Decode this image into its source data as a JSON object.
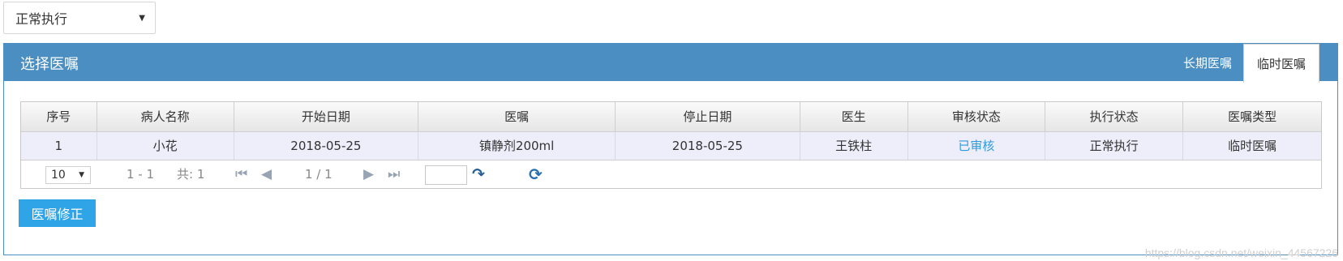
{
  "top_select": {
    "value": "正常执行"
  },
  "panel": {
    "title": "选择医嘱",
    "tabs": [
      {
        "label": "长期医嘱",
        "active": false
      },
      {
        "label": "临时医嘱",
        "active": true
      }
    ]
  },
  "grid": {
    "columns": [
      "序号",
      "病人名称",
      "开始日期",
      "医嘱",
      "停止日期",
      "医生",
      "审核状态",
      "执行状态",
      "医嘱类型"
    ],
    "rows": [
      [
        "1",
        "小花",
        "2018-05-25",
        "镇静剂200ml",
        "2018-05-25",
        "王铁柱",
        "已审核",
        "正常执行",
        "临时医嘱"
      ]
    ],
    "pager": {
      "page_size": "10",
      "range": "1 - 1",
      "total": "共: 1",
      "page": "1 / 1",
      "goto_value": ""
    }
  },
  "actions": {
    "edit_button": "医嘱修正"
  },
  "watermark": "https://blog.csdn.net/weixin_44567226",
  "colors": {
    "header": "#4b8ec1",
    "button": "#2fa4e7",
    "link": "#2f9bdb",
    "row": "#eeeefb"
  }
}
